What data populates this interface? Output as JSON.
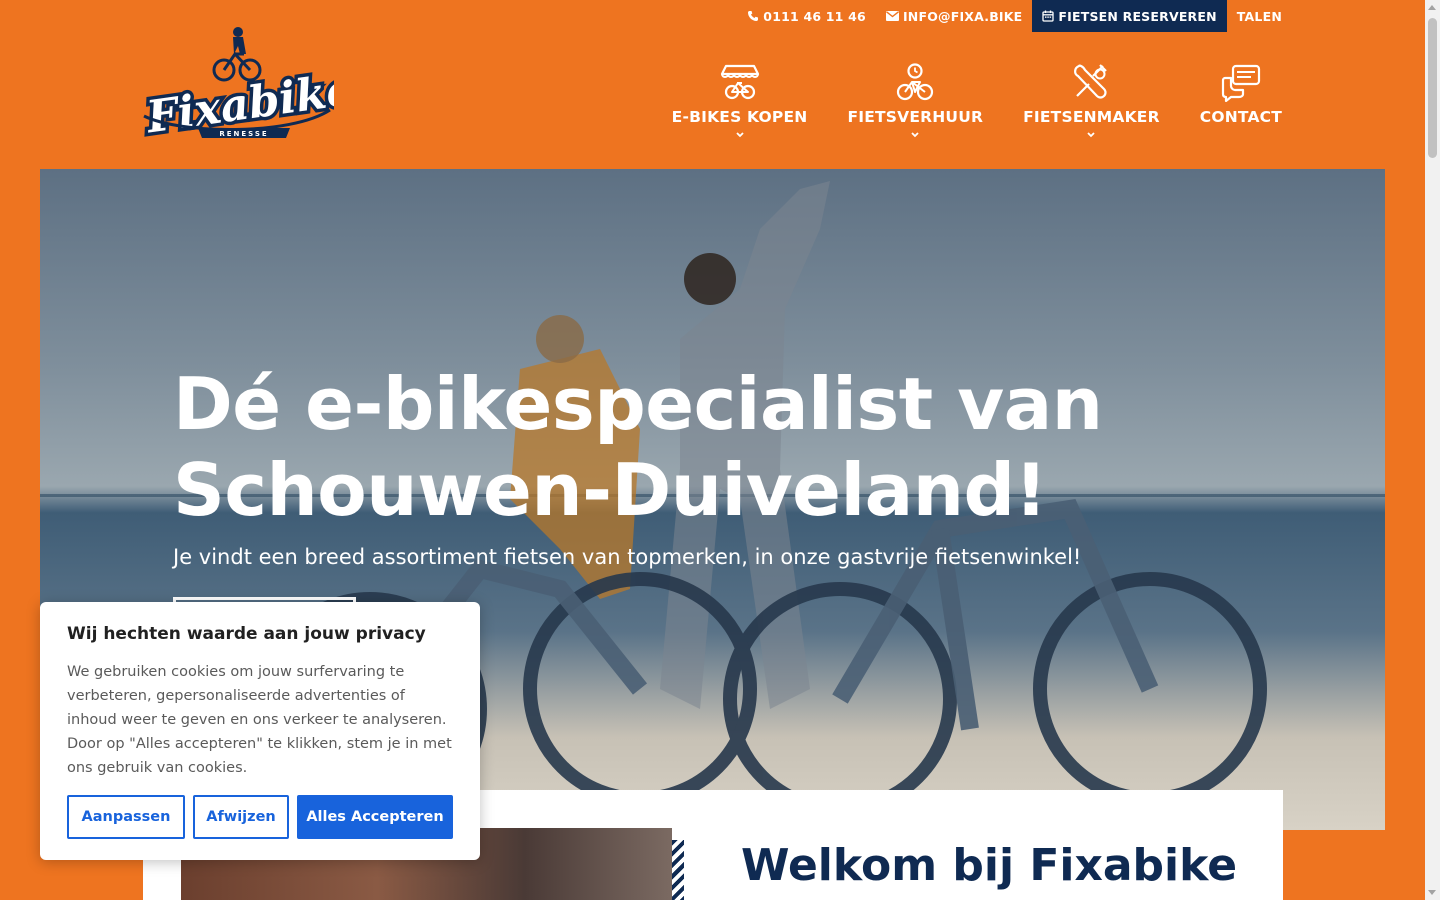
{
  "topbar": {
    "phone": "0111 46 11 46",
    "email": "INFO@FIXA.BIKE",
    "reserve": "FIETSEN RESERVEREN",
    "languages": "TALEN"
  },
  "logo": {
    "brand": "Fixabike",
    "location": "RENESSE"
  },
  "nav": {
    "items": [
      {
        "label": "E-BIKES KOPEN",
        "icon": "bike-shop-icon",
        "has_dropdown": true
      },
      {
        "label": "FIETSVERHUUR",
        "icon": "bike-rental-icon",
        "has_dropdown": true
      },
      {
        "label": "FIETSENMAKER",
        "icon": "repair-tools-icon",
        "has_dropdown": true
      },
      {
        "label": "CONTACT",
        "icon": "chat-bubbles-icon",
        "has_dropdown": false
      }
    ]
  },
  "hero": {
    "title_line1": "Dé e-bikespecialist van",
    "title_line2": "Schouwen-Duiveland!",
    "subtitle": "Je vindt een breed assortiment fietsen van topmerken, in onze gastvrije fietsenwinkel!"
  },
  "welcome": {
    "heading": "Welkom bij Fixabike"
  },
  "cookie": {
    "title": "Wij hechten waarde aan jouw privacy",
    "body": "We gebruiken cookies om jouw surfervaring te verbeteren, gepersonaliseerde advertenties of inhoud weer te geven en ons verkeer te analyseren. Door op \"Alles accepteren\" te klikken, stem je in met ons gebruik van cookies.",
    "customize": "Aanpassen",
    "reject": "Afwijzen",
    "accept_all": "Alles Accepteren"
  },
  "colors": {
    "brand_orange": "#ee7420",
    "brand_navy": "#0f2a52",
    "cookie_blue": "#1863dc"
  }
}
